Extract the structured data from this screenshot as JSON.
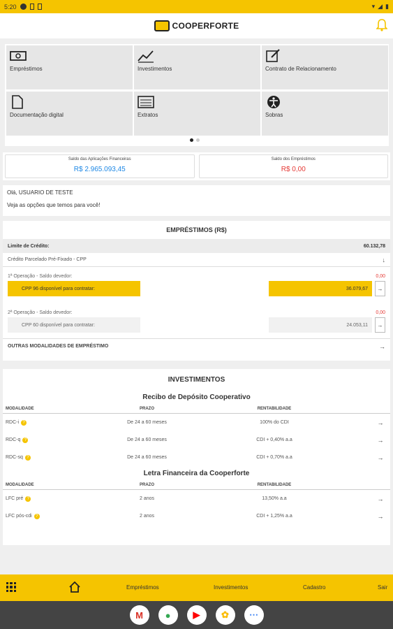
{
  "status": {
    "time": "5:20"
  },
  "header": {
    "brand": "COOPERFORTE"
  },
  "tiles": [
    {
      "label": "Empréstimos",
      "icon": "money-icon"
    },
    {
      "label": "Investimentos",
      "icon": "trend-icon"
    },
    {
      "label": "Contrato de Relacionamento",
      "icon": "edit-icon"
    },
    {
      "label": "Documentação digital",
      "icon": "document-icon"
    },
    {
      "label": "Extratos",
      "icon": "statement-icon"
    },
    {
      "label": "Sobras",
      "icon": "accessibility-icon"
    }
  ],
  "balances": {
    "investments_title": "Saldo das Aplicações Financeiras",
    "investments_value": "R$ 2.965.093,45",
    "loans_title": "Saldo dos Empréstimos",
    "loans_value": "R$ 0,00"
  },
  "greeting": {
    "line1": "Olá, USUARIO DE TESTE",
    "line2": "Veja as opções que temos para você!"
  },
  "loans": {
    "title": "EMPRÉSTIMOS (R$)",
    "limit_label": "Limite de Crédito:",
    "limit_value": "60.132,78",
    "cpp_label": "Crédito Parcelado Pré-Fixado - CPP",
    "op1_label": "1ª Operação - Saldo devedor:",
    "op1_value": "0,00",
    "op1_avail_label": "CPP 96 disponível para contratar:",
    "op1_avail_value": "36.079,67",
    "op2_label": "2ª Operação - Saldo devedor:",
    "op2_value": "0,00",
    "op2_avail_label": "CPP 60 disponível para contratar:",
    "op2_avail_value": "24.053,11",
    "other_label": "OUTRAS MODALIDADES DE EMPRÉSTIMO"
  },
  "investments": {
    "title": "INVESTIMENTOS",
    "rdc_title": "Recibo de Depósito Cooperativo",
    "lfc_title": "Letra Financeira da Cooperforte",
    "headers": {
      "modality": "MODALIDADE",
      "term": "PRAZO",
      "yield": "RENTABILIDADE"
    },
    "rdc_rows": [
      {
        "modality": "RDC-i",
        "term": "De 24 a 60 meses",
        "yield": "100% do CDI"
      },
      {
        "modality": "RDC-q",
        "term": "De 24 a 60 meses",
        "yield": "CDI + 0,40% a.a"
      },
      {
        "modality": "RDC-sq",
        "term": "De 24 a 60 meses",
        "yield": "CDI + 0,70% a.a"
      }
    ],
    "lfc_rows": [
      {
        "modality": "LFC pré",
        "term": "2 anos",
        "yield": "13,50% a.a"
      },
      {
        "modality": "LFC pós-cdi",
        "term": "2 anos",
        "yield": "CDI + 1,25% a.a"
      }
    ]
  },
  "nav": {
    "loans": "Empréstimos",
    "investments": "Investimentos",
    "register": "Cadastro",
    "exit": "Sair"
  },
  "dock": {
    "gmail": "M",
    "chrome": "●",
    "youtube": "▶",
    "photos": "✿",
    "apps": "⋯"
  },
  "colors": {
    "accent": "#f5c400",
    "blue": "#1e88e5",
    "red": "#e53935"
  }
}
